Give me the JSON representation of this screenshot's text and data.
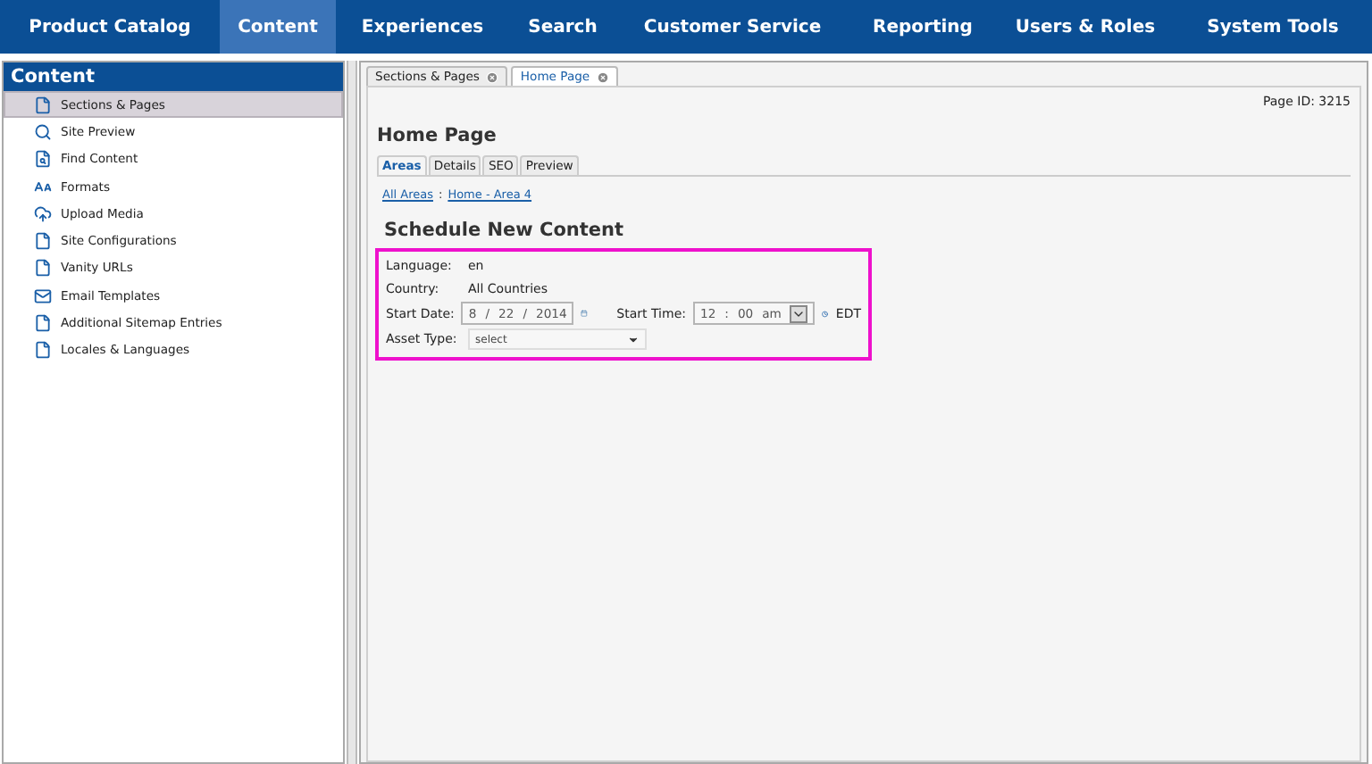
{
  "nav": [
    {
      "label": "Product Catalog",
      "selected": false
    },
    {
      "label": "Content",
      "selected": true
    },
    {
      "label": "Experiences",
      "selected": false
    },
    {
      "label": "Search",
      "selected": false
    },
    {
      "label": "Customer Service",
      "selected": false
    },
    {
      "label": "Reporting",
      "selected": false
    },
    {
      "label": "Users & Roles",
      "selected": false
    },
    {
      "label": "System Tools",
      "selected": false
    }
  ],
  "sidebar": {
    "title": "Content",
    "items": [
      {
        "label": "Sections & Pages",
        "selected": true
      },
      {
        "label": "Site Preview",
        "selected": false
      },
      {
        "label": "Find Content",
        "selected": false
      },
      {
        "label": "Formats",
        "selected": false
      },
      {
        "label": "Upload Media",
        "selected": false
      },
      {
        "label": "Site Configurations",
        "selected": false
      },
      {
        "label": "Vanity URLs",
        "selected": false
      },
      {
        "label": "Email Templates",
        "selected": false
      },
      {
        "label": "Additional Sitemap Entries",
        "selected": false
      },
      {
        "label": "Locales & Languages",
        "selected": false
      }
    ]
  },
  "doc_tabs": [
    {
      "label": "Sections & Pages",
      "selected": false
    },
    {
      "label": "Home Page",
      "selected": true
    }
  ],
  "page_id": "Page ID: 3215",
  "page_title": "Home Page",
  "page_tabs": [
    {
      "label": "Areas",
      "selected": true
    },
    {
      "label": "Details",
      "selected": false
    },
    {
      "label": "SEO",
      "selected": false
    },
    {
      "label": "Preview",
      "selected": false
    }
  ],
  "breadcrumb": {
    "links": [
      "All Areas",
      "Home - Area 4"
    ],
    "separator": ":"
  },
  "heading": "Schedule New Content",
  "form": {
    "language": {
      "label": "Language:",
      "value": "en"
    },
    "country": {
      "label": "Country:",
      "value": "All Countries"
    },
    "start_date": {
      "label": "Start Date:",
      "parts": [
        "8",
        "/",
        "22",
        "/",
        "2014"
      ]
    },
    "start_time": {
      "label": "Start Time:",
      "parts": [
        "12",
        ":",
        "00",
        "am"
      ],
      "timezone": "EDT"
    },
    "asset_type": {
      "label": "Asset Type:",
      "value": "select"
    }
  }
}
